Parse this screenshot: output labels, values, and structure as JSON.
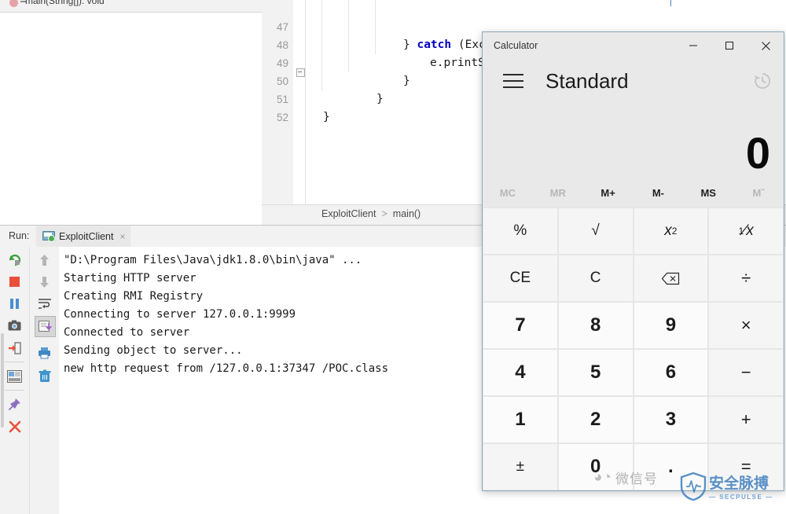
{
  "ide": {
    "structure_item": "main(String[]): void",
    "breadcrumb": {
      "class": "ExploitClient",
      "separator": ">",
      "method": "main()"
    },
    "editor": {
      "lines": [
        {
          "number": "47",
          "text": "} catch (Exception e) {",
          "indent": 12
        },
        {
          "number": "48",
          "text": "e.printStackTrace();",
          "indent": 16
        },
        {
          "number": "49",
          "text": "}",
          "indent": 12
        },
        {
          "number": "50",
          "text": "}",
          "indent": 8
        },
        {
          "number": "51",
          "text": "}",
          "indent": 4
        },
        {
          "number": "52",
          "text": "",
          "indent": 0
        }
      ]
    },
    "run_panel": {
      "label": "Run:",
      "tab_name": "ExploitClient",
      "tab_close": "×",
      "console_lines": [
        {
          "text": "\"D:\\Program Files\\Java\\jdk1.8.0\\bin\\java\" ...",
          "highlight": true
        },
        {
          "text": "Starting HTTP server",
          "highlight": false
        },
        {
          "text": "Creating RMI Registry",
          "highlight": false
        },
        {
          "text": "Connecting to server 127.0.0.1:9999",
          "highlight": false
        },
        {
          "text": "Connected to server",
          "highlight": false
        },
        {
          "text": "Sending object to server...",
          "highlight": false
        },
        {
          "text": "new http request from /127.0.0.1:37347 /POC.class",
          "highlight": false
        }
      ],
      "toolbar_primary": [
        "rerun-icon",
        "stop-icon",
        "pause-icon",
        "thread-dump-icon",
        "exit-icon",
        "console-layout-icon",
        "pin-tab-icon",
        "close-icon"
      ],
      "toolbar_secondary": [
        "scroll-up-icon",
        "scroll-down-icon",
        "soft-wrap-icon",
        "scroll-to-end-icon",
        "print-icon",
        "clear-all-icon"
      ]
    }
  },
  "calculator": {
    "window_title": "Calculator",
    "window_buttons": {
      "minimize": "─",
      "maximize": "□",
      "close": "✕"
    },
    "menu_icon": "hamburger-menu-icon",
    "mode": "Standard",
    "history_icon": "history-icon",
    "display_value": "0",
    "memory_buttons": [
      {
        "label": "MC",
        "enabled": false
      },
      {
        "label": "MR",
        "enabled": false
      },
      {
        "label": "M+",
        "enabled": true
      },
      {
        "label": "M-",
        "enabled": true
      },
      {
        "label": "MS",
        "enabled": true
      },
      {
        "label": "Mˇ",
        "enabled": false
      }
    ],
    "keys": [
      {
        "label": "%",
        "name": "percent-key",
        "type": "func"
      },
      {
        "label": "√",
        "name": "sqrt-key",
        "type": "func"
      },
      {
        "label": "x²",
        "name": "square-key",
        "type": "func"
      },
      {
        "label": "¹/x",
        "name": "reciprocal-key",
        "type": "func"
      },
      {
        "label": "CE",
        "name": "clear-entry-key",
        "type": "func"
      },
      {
        "label": "C",
        "name": "clear-key",
        "type": "func"
      },
      {
        "label": "⌫",
        "name": "backspace-key",
        "type": "func"
      },
      {
        "label": "÷",
        "name": "divide-key",
        "type": "op"
      },
      {
        "label": "7",
        "name": "digit-7-key",
        "type": "digit"
      },
      {
        "label": "8",
        "name": "digit-8-key",
        "type": "digit"
      },
      {
        "label": "9",
        "name": "digit-9-key",
        "type": "digit"
      },
      {
        "label": "×",
        "name": "multiply-key",
        "type": "op"
      },
      {
        "label": "4",
        "name": "digit-4-key",
        "type": "digit"
      },
      {
        "label": "5",
        "name": "digit-5-key",
        "type": "digit"
      },
      {
        "label": "6",
        "name": "digit-6-key",
        "type": "digit"
      },
      {
        "label": "−",
        "name": "subtract-key",
        "type": "op"
      },
      {
        "label": "1",
        "name": "digit-1-key",
        "type": "digit"
      },
      {
        "label": "2",
        "name": "digit-2-key",
        "type": "digit"
      },
      {
        "label": "3",
        "name": "digit-3-key",
        "type": "digit"
      },
      {
        "label": "+",
        "name": "add-key",
        "type": "op"
      },
      {
        "label": "±",
        "name": "negate-key",
        "type": "func"
      },
      {
        "label": "0",
        "name": "digit-0-key",
        "type": "digit"
      },
      {
        "label": ".",
        "name": "decimal-key",
        "type": "digit"
      },
      {
        "label": "=",
        "name": "equals-key",
        "type": "op"
      }
    ]
  },
  "watermark": {
    "wechat_label": "微信号",
    "brand_cn": "安全脉搏",
    "brand_en": "—  SECPULSE  —"
  },
  "colors": {
    "calc_window_bg": "#e9e9e9",
    "calc_key_bg": "#f5f5f5",
    "calc_digit_bg": "#fbfbfb",
    "calc_border": "#8ca9bd",
    "console_highlight": "#e2f2e2",
    "ide_panel_bg": "#f2f2f2",
    "brand_blue": "#3f7fbf"
  }
}
